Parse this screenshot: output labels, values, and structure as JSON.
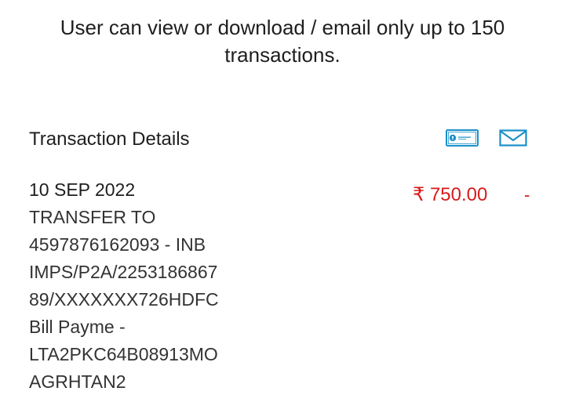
{
  "notice": {
    "line1": "User can view or download / email only up to 150",
    "line2": "transactions."
  },
  "section": {
    "title": "Transaction Details"
  },
  "icons": {
    "passbook": "passbook-card-icon",
    "email": "envelope-icon"
  },
  "transactions": [
    {
      "date": "10 SEP 2022",
      "description_lines": [
        "TRANSFER TO",
        "4597876162093 - INB",
        "IMPS/P2A/2253186867",
        "89/XXXXXXX726HDFC",
        "Bill Payme -",
        "LTA2PKC64B08913MO",
        "AGRHTAN2"
      ],
      "amount": "₹ 750.00",
      "credit": "-"
    }
  ],
  "colors": {
    "accent": "#1a90c9",
    "debit": "#d81a1a",
    "text": "#1e1e1e"
  }
}
